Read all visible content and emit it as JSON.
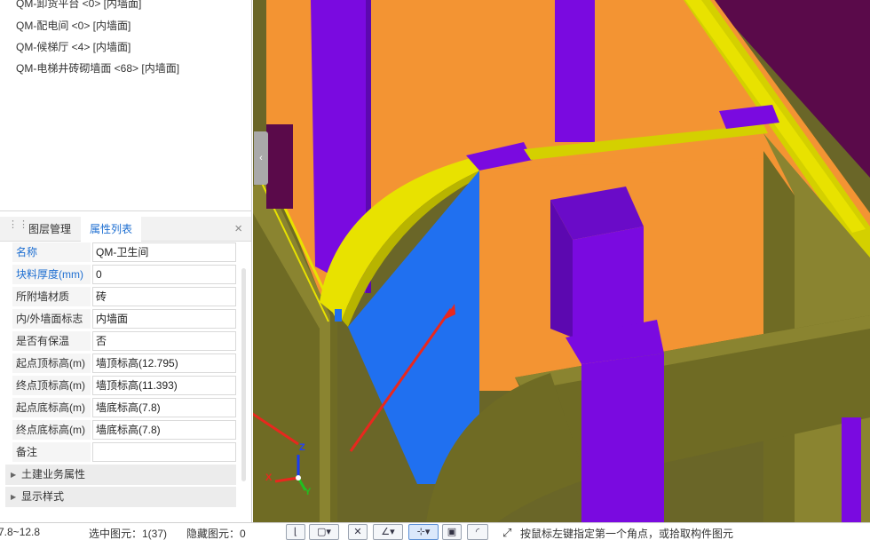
{
  "wall_list": [
    "QM-卸货平台 <0> [内墙面]",
    "QM-配电间 <0> [内墙面]",
    "QM-候梯厅 <4> [内墙面]",
    "QM-电梯井砖砌墙面 <68> [内墙面]"
  ],
  "tabs": {
    "layer": "图层管理",
    "props": "属性列表",
    "close": "×"
  },
  "properties": [
    {
      "label": "名称",
      "value": "QM-卫生间",
      "highlight": true
    },
    {
      "label": "块料厚度(mm)",
      "value": "0",
      "highlight": true
    },
    {
      "label": "所附墙材质",
      "value": "砖"
    },
    {
      "label": "内/外墙面标志",
      "value": "内墙面"
    },
    {
      "label": "是否有保温",
      "value": "否"
    },
    {
      "label": "起点顶标高(m)",
      "value": "墙顶标高(12.795)"
    },
    {
      "label": "终点顶标高(m)",
      "value": "墙顶标高(11.393)"
    },
    {
      "label": "起点底标高(m)",
      "value": "墙底标高(7.8)"
    },
    {
      "label": "终点底标高(m)",
      "value": "墙底标高(7.8)"
    },
    {
      "label": "备注",
      "value": ""
    }
  ],
  "groups": [
    "土建业务属性",
    "显示样式"
  ],
  "statusbar": {
    "range": "7.8~12.8",
    "selected": "选中图元：1(37)",
    "hidden": "隐藏图元：0",
    "hint": "按鼠标左键指定第一个角点，或拾取构件图元"
  },
  "axis_labels": {
    "z": "Z",
    "x": "X",
    "y": "Y"
  },
  "colors": {
    "wall_orange": "#f39433",
    "column_purple": "#7a0ae0",
    "slab_olive": "#6f6b24",
    "edge_yellow": "#e8e200",
    "face_blue": "#2070f0",
    "arrow_red": "#e8281e",
    "accent_blue": "#1d6ed1"
  },
  "icons": [
    "grip-icon",
    "close-icon",
    "collapse-arrow-icon",
    "axis-gizmo-icon",
    "select-tool-icon",
    "box-select-icon",
    "cross-icon",
    "line-tool-icon",
    "snap-icon",
    "view-icon",
    "arc-icon",
    "resize-arrow-icon"
  ]
}
